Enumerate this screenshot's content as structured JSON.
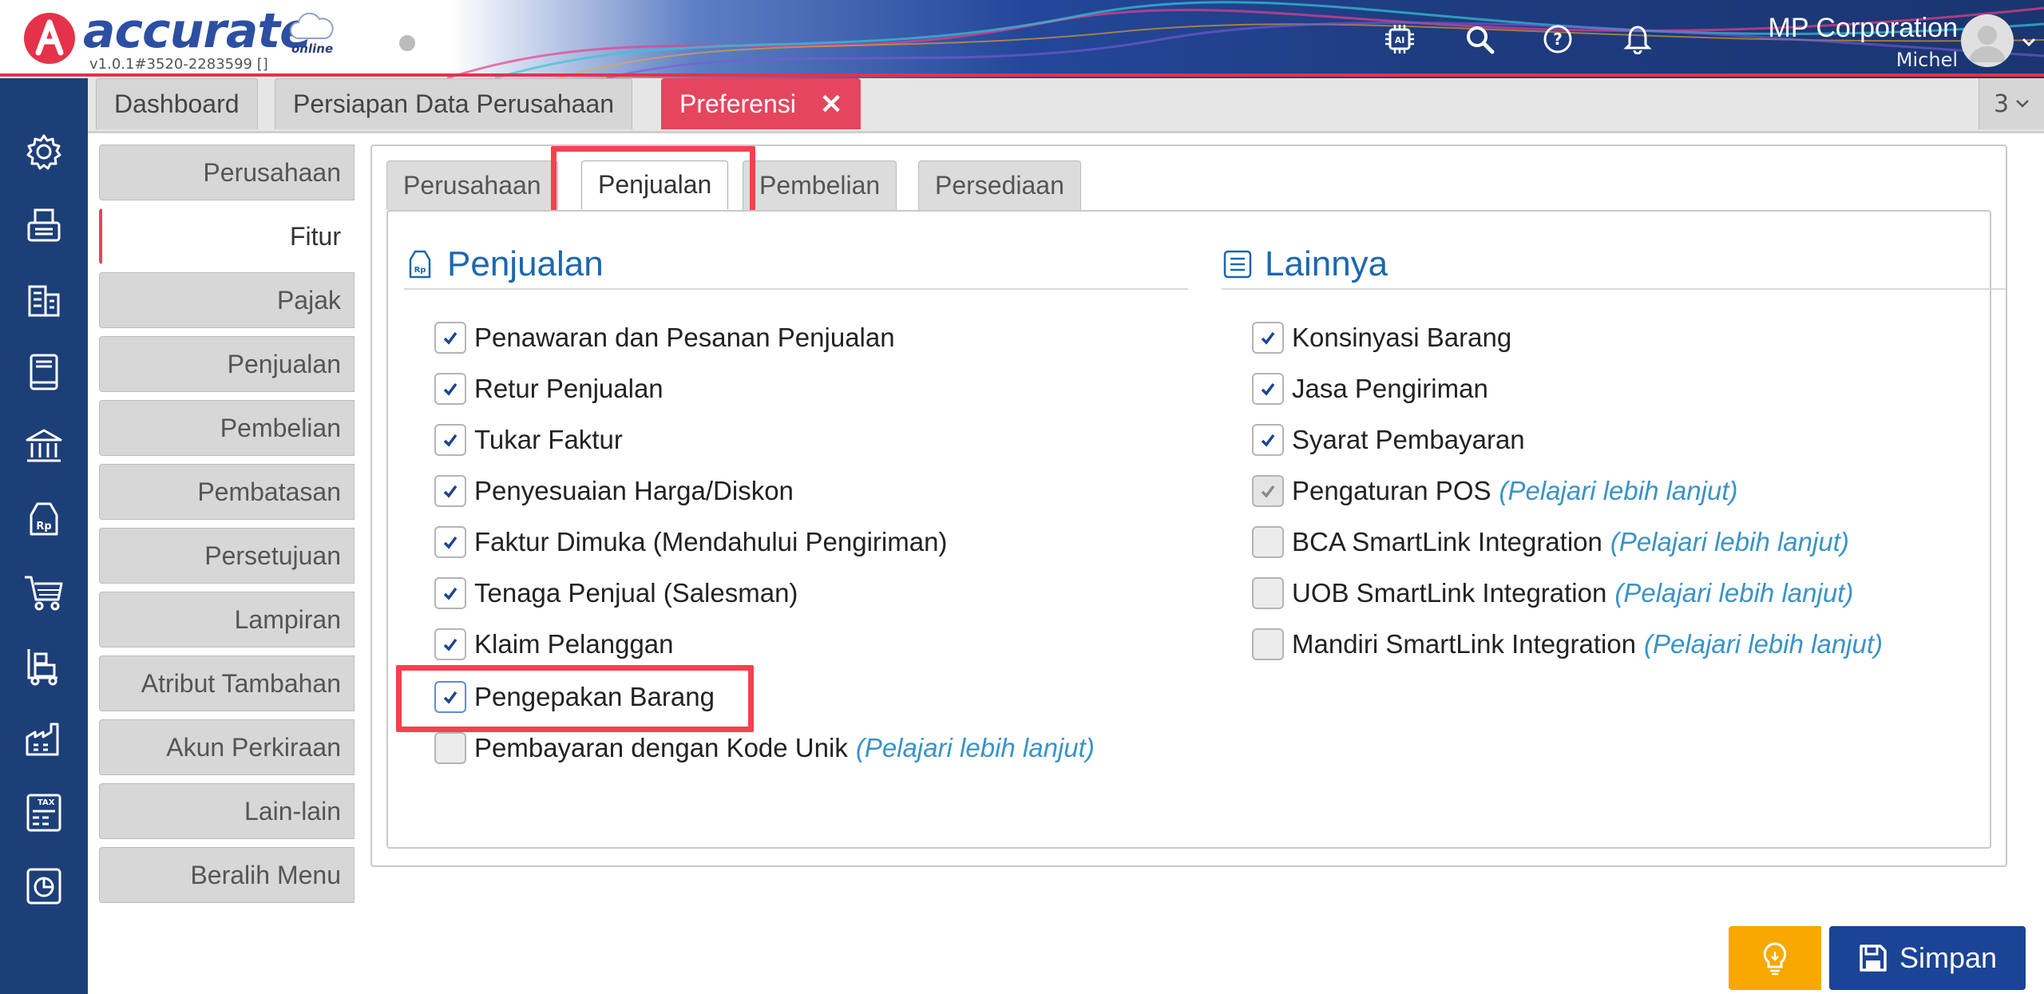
{
  "header": {
    "brand_name": "accurate",
    "brand_online": "online",
    "version": "v1.0.1#3520-2283599 []",
    "company_name": "MP Corporation",
    "user_name": "Michel"
  },
  "main_tabs": [
    {
      "label": "Dashboard"
    },
    {
      "label": "Persiapan Data Perusahaan"
    },
    {
      "label": "Preferensi"
    }
  ],
  "tab_count": "3",
  "side_menu": [
    {
      "label": "Perusahaan"
    },
    {
      "label": "Fitur"
    },
    {
      "label": "Pajak"
    },
    {
      "label": "Penjualan"
    },
    {
      "label": "Pembelian"
    },
    {
      "label": "Pembatasan"
    },
    {
      "label": "Persetujuan"
    },
    {
      "label": "Lampiran"
    },
    {
      "label": "Atribut Tambahan"
    },
    {
      "label": "Akun Perkiraan"
    },
    {
      "label": "Lain-lain"
    },
    {
      "label": "Beralih Menu"
    }
  ],
  "sub_tabs": [
    {
      "label": "Perusahaan"
    },
    {
      "label": "Penjualan"
    },
    {
      "label": "Pembelian"
    },
    {
      "label": "Persediaan"
    }
  ],
  "left_section": {
    "title": "Penjualan",
    "options": [
      {
        "label": "Penawaran dan Pesanan Penjualan",
        "checked": true
      },
      {
        "label": "Retur Penjualan",
        "checked": true
      },
      {
        "label": "Tukar Faktur",
        "checked": true
      },
      {
        "label": "Penyesuaian Harga/Diskon",
        "checked": true
      },
      {
        "label": "Faktur Dimuka (Mendahului Pengiriman)",
        "checked": true
      },
      {
        "label": "Tenaga Penjual (Salesman)",
        "checked": true
      },
      {
        "label": "Klaim Pelanggan",
        "checked": true
      },
      {
        "label": "Pengepakan Barang",
        "checked": true
      },
      {
        "label": "Pembayaran dengan Kode Unik",
        "checked": false,
        "link": "(Pelajari lebih lanjut)"
      }
    ]
  },
  "right_section": {
    "title": "Lainnya",
    "options": [
      {
        "label": "Konsinyasi Barang",
        "checked": true
      },
      {
        "label": "Jasa Pengiriman",
        "checked": true
      },
      {
        "label": "Syarat Pembayaran",
        "checked": true
      },
      {
        "label": "Pengaturan POS",
        "checked": true,
        "link": "(Pelajari lebih lanjut)"
      },
      {
        "label": "BCA SmartLink Integration",
        "checked": false,
        "link": "(Pelajari lebih lanjut)"
      },
      {
        "label": "UOB SmartLink Integration",
        "checked": false,
        "link": "(Pelajari lebih lanjut)"
      },
      {
        "label": "Mandiri SmartLink Integration",
        "checked": false,
        "link": "(Pelajari lebih lanjut)"
      }
    ]
  },
  "buttons": {
    "save_label": "Simpan"
  },
  "colors": {
    "nav_blue": "#1d3f78",
    "accent_red": "#e5455e",
    "link_blue": "#3a93c7",
    "section_blue": "#1b67b2",
    "save_blue": "#1b4496",
    "idea_orange": "#f8a800"
  }
}
